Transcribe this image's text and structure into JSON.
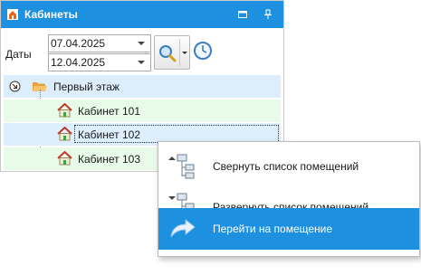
{
  "window": {
    "title": "Кабинеты",
    "title_icon": "home-icon",
    "maximize_icon": "maximize-icon",
    "pin_icon": "pin-icon",
    "accent_color": "#1e90e0"
  },
  "filter": {
    "dates_label": "Даты",
    "date_from": "07.04.2025",
    "date_to": "12.04.2025",
    "search_icon": "magnifier-icon",
    "clock_icon": "clock-icon"
  },
  "tree": {
    "root": {
      "label": "Первый этаж",
      "expander_icon": "collapse-arrow-icon",
      "icon": "folder-open-icon"
    },
    "rooms": [
      {
        "label": "Кабинет 101",
        "icon": "house-icon",
        "row_color": "#e8fbe8"
      },
      {
        "label": "Кабинет 102",
        "icon": "house-icon",
        "row_color": "#ddeefc",
        "selected": true
      },
      {
        "label": "Кабинет 103",
        "icon": "house-icon",
        "row_color": "#e8fbe8"
      }
    ]
  },
  "context_menu": {
    "items": [
      {
        "label": "Свернуть список помещений",
        "icon": "collapse-tree-icon"
      },
      {
        "label": "Развернуть список помещений",
        "icon": "expand-tree-icon"
      },
      {
        "label": "Перейти на помещение",
        "icon": "go-arrow-icon",
        "highlighted": true
      }
    ],
    "highlight_color": "#1e90e0"
  }
}
